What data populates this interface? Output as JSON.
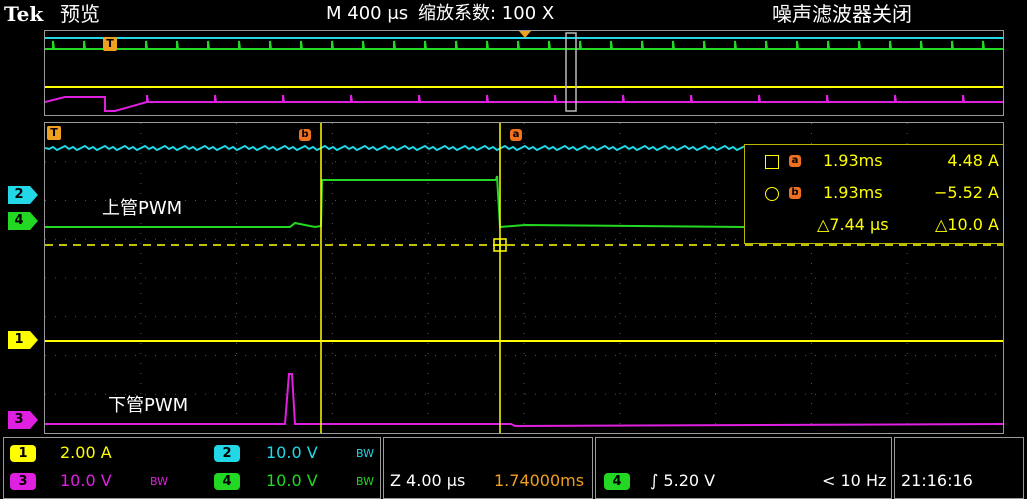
{
  "header": {
    "brand": "Tek",
    "mode": "预览",
    "timebase": "M 400 μs",
    "zoom_factor": "缩放系数: 100 X",
    "noise_filter": "噪声滤波器关闭"
  },
  "markers": {
    "ch1": "1",
    "ch2": "2",
    "ch3": "3",
    "ch4": "4",
    "trigger": "T",
    "cursor_a": "a",
    "cursor_b": "b"
  },
  "annotations": {
    "upper_pwm": "上管PWM",
    "lower_pwm": "下管PWM"
  },
  "readout": {
    "a_time": "1.93ms",
    "a_value": "4.48 A",
    "b_time": "1.93ms",
    "b_value": "−5.52 A",
    "delta_time": "△7.44 μs",
    "delta_value": "△10.0 A"
  },
  "channels": {
    "ch1": {
      "num": "1",
      "scale": "2.00 A",
      "color": "#ffff00"
    },
    "ch2": {
      "num": "2",
      "scale": "10.0 V",
      "color": "#22d8e6"
    },
    "ch3": {
      "num": "3",
      "scale": "10.0 V",
      "color": "#e020e0"
    },
    "ch4": {
      "num": "4",
      "scale": "10.0 V",
      "color": "#22d822"
    },
    "bw_label": "BW"
  },
  "horizontal": {
    "zoom_scale": "Z 4.00 μs",
    "position": "1.74000ms"
  },
  "trigger": {
    "source": "4",
    "slope_level": "∫ 5.20 V",
    "frequency": "< 10 Hz"
  },
  "clock": "21:16:16"
}
